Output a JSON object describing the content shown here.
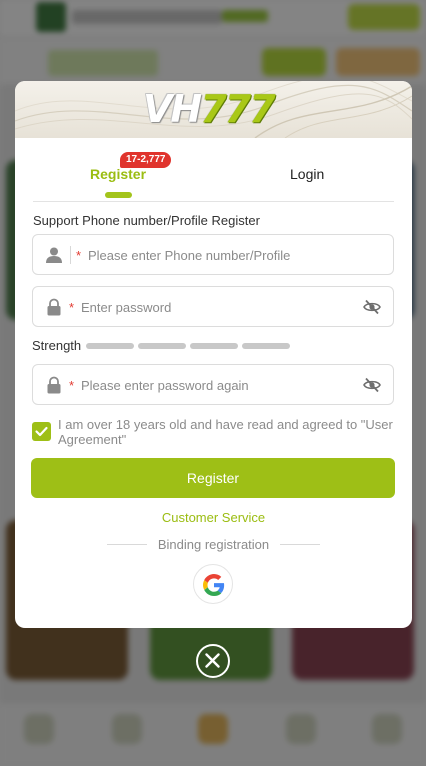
{
  "brand": {
    "logo_text": "VH777",
    "accent_color": "#9ebf16",
    "badge_color": "#e0342d"
  },
  "tabs": [
    {
      "label": "Register",
      "active": true,
      "badge": "17-2,777"
    },
    {
      "label": "Login",
      "active": false
    }
  ],
  "form": {
    "phone_label": "Support Phone number/Profile Register",
    "phone": {
      "value": "",
      "placeholder": "Please enter Phone number/Profile",
      "required_mark": "*",
      "icon": "user-icon"
    },
    "password": {
      "value": "",
      "placeholder": "Enter password",
      "required_mark": "*",
      "icon": "lock-icon",
      "toggle_icon": "eye-off-icon"
    },
    "strength": {
      "label": "Strength",
      "segments": 4,
      "filled": 0
    },
    "confirm_password": {
      "value": "",
      "placeholder": "Please enter password again",
      "required_mark": "*",
      "icon": "lock-icon",
      "toggle_icon": "eye-off-icon"
    },
    "agreement": {
      "checked": true,
      "text": "I am over 18 years old and have read and agreed to \"User Agreement\""
    },
    "submit_label": "Register"
  },
  "links": {
    "customer_service": "Customer Service",
    "binding_registration": "Binding registration"
  },
  "social": [
    {
      "name": "google-icon"
    }
  ],
  "close_icon": "close-icon"
}
